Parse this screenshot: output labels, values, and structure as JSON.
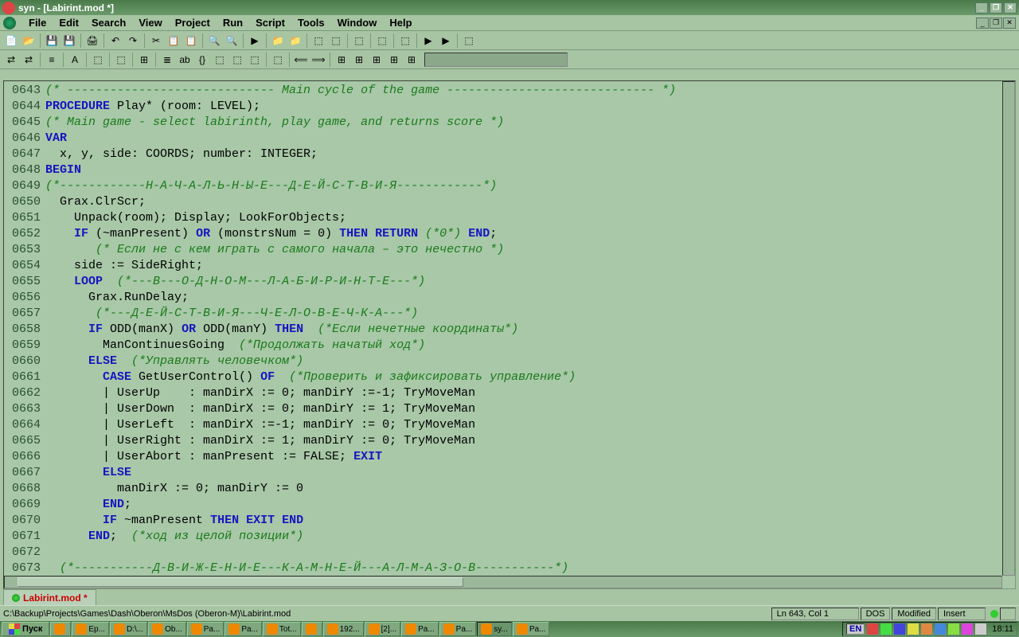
{
  "title": "syn - [Labirint.mod *]",
  "menu": [
    "File",
    "Edit",
    "Search",
    "View",
    "Project",
    "Run",
    "Script",
    "Tools",
    "Window",
    "Help"
  ],
  "tab": {
    "name": "Labirint.mod *"
  },
  "status": {
    "path": "C:\\Backup\\Projects\\Games\\Dash\\Oberon\\MsDos (Oberon-M)\\Labirint.mod",
    "pos": "Ln 643, Col 1",
    "enc": "DOS",
    "mod": "Modified",
    "ins": "Insert"
  },
  "taskbar": {
    "start": "Пуск",
    "tasks": [
      "",
      "Ер...",
      "D:\\...",
      "Ob...",
      "Pa...",
      "Pa...",
      "Tot...",
      "",
      "192...",
      "[2]...",
      "Pa...",
      "Pa...",
      "sy...",
      "Pa..."
    ],
    "lang": "EN",
    "clock": "18:11"
  },
  "code": [
    {
      "n": "0643",
      "seg": [
        {
          "c": "cm",
          "t": "(* ----------------------------- Main cycle of the game ----------------------------- *)"
        }
      ]
    },
    {
      "n": "0644",
      "seg": [
        {
          "c": "kw",
          "t": "PROCEDURE"
        },
        {
          "c": "txt",
          "t": " Play* (room: LEVEL);"
        }
      ]
    },
    {
      "n": "0645",
      "seg": [
        {
          "c": "cm",
          "t": "(* Main game - select labirinth, play game, and returns score *)"
        }
      ]
    },
    {
      "n": "0646",
      "seg": [
        {
          "c": "kw",
          "t": "VAR"
        }
      ]
    },
    {
      "n": "0647",
      "seg": [
        {
          "c": "txt",
          "t": "  x, y, side: COORDS; number: INTEGER;"
        }
      ]
    },
    {
      "n": "0648",
      "seg": [
        {
          "c": "kw",
          "t": "BEGIN"
        }
      ]
    },
    {
      "n": "0649",
      "seg": [
        {
          "c": "cm",
          "t": "(*------------Н-А-Ч-А-Л-Ь-Н-Ы-Е---Д-Е-Й-С-Т-В-И-Я------------*)"
        }
      ]
    },
    {
      "n": "0650",
      "seg": [
        {
          "c": "txt",
          "t": "  Grax.ClrScr;"
        }
      ]
    },
    {
      "n": "0651",
      "seg": [
        {
          "c": "txt",
          "t": "    Unpack(room); Display; LookForObjects;"
        }
      ]
    },
    {
      "n": "0652",
      "seg": [
        {
          "c": "txt",
          "t": "    "
        },
        {
          "c": "kw",
          "t": "IF"
        },
        {
          "c": "txt",
          "t": " (~manPresent) "
        },
        {
          "c": "kw",
          "t": "OR"
        },
        {
          "c": "txt",
          "t": " (monstrsNum = 0) "
        },
        {
          "c": "kw",
          "t": "THEN RETURN"
        },
        {
          "c": "txt",
          "t": " "
        },
        {
          "c": "cm",
          "t": "(*0*)"
        },
        {
          "c": "txt",
          "t": " "
        },
        {
          "c": "kw",
          "t": "END"
        },
        {
          "c": "txt",
          "t": ";"
        }
      ]
    },
    {
      "n": "0653",
      "seg": [
        {
          "c": "txt",
          "t": "       "
        },
        {
          "c": "cm",
          "t": "(* Если не с кем играть с самого начала – это нечестно *)"
        }
      ]
    },
    {
      "n": "0654",
      "seg": [
        {
          "c": "txt",
          "t": "    side := SideRight;"
        }
      ]
    },
    {
      "n": "0655",
      "seg": [
        {
          "c": "txt",
          "t": "    "
        },
        {
          "c": "kw",
          "t": "LOOP"
        },
        {
          "c": "txt",
          "t": "  "
        },
        {
          "c": "cm",
          "t": "(*---В---О-Д-Н-О-М---Л-А-Б-И-Р-И-Н-Т-Е---*)"
        }
      ]
    },
    {
      "n": "0656",
      "seg": [
        {
          "c": "txt",
          "t": "      Grax.RunDelay;"
        }
      ]
    },
    {
      "n": "0657",
      "seg": [
        {
          "c": "txt",
          "t": "       "
        },
        {
          "c": "cm",
          "t": "(*---Д-Е-Й-С-Т-В-И-Я---Ч-Е-Л-О-В-Е-Ч-К-А---*)"
        }
      ]
    },
    {
      "n": "0658",
      "seg": [
        {
          "c": "txt",
          "t": "      "
        },
        {
          "c": "kw",
          "t": "IF"
        },
        {
          "c": "txt",
          "t": " ODD(manX) "
        },
        {
          "c": "kw",
          "t": "OR"
        },
        {
          "c": "txt",
          "t": " ODD(manY) "
        },
        {
          "c": "kw",
          "t": "THEN"
        },
        {
          "c": "txt",
          "t": "  "
        },
        {
          "c": "cm",
          "t": "(*Если нечетные координаты*)"
        }
      ]
    },
    {
      "n": "0659",
      "seg": [
        {
          "c": "txt",
          "t": "        ManContinuesGoing  "
        },
        {
          "c": "cm",
          "t": "(*Продолжать начатый ход*)"
        }
      ]
    },
    {
      "n": "0660",
      "seg": [
        {
          "c": "txt",
          "t": "      "
        },
        {
          "c": "kw",
          "t": "ELSE"
        },
        {
          "c": "txt",
          "t": "  "
        },
        {
          "c": "cm",
          "t": "(*Управлять человечком*)"
        }
      ]
    },
    {
      "n": "0661",
      "seg": [
        {
          "c": "txt",
          "t": "        "
        },
        {
          "c": "kw",
          "t": "CASE"
        },
        {
          "c": "txt",
          "t": " GetUserControl() "
        },
        {
          "c": "kw",
          "t": "OF"
        },
        {
          "c": "txt",
          "t": "  "
        },
        {
          "c": "cm",
          "t": "(*Проверить и зафиксировать управление*)"
        }
      ]
    },
    {
      "n": "0662",
      "seg": [
        {
          "c": "txt",
          "t": "        | UserUp    : manDirX := 0; manDirY :=-1; TryMoveMan"
        }
      ]
    },
    {
      "n": "0663",
      "seg": [
        {
          "c": "txt",
          "t": "        | UserDown  : manDirX := 0; manDirY := 1; TryMoveMan"
        }
      ]
    },
    {
      "n": "0664",
      "seg": [
        {
          "c": "txt",
          "t": "        | UserLeft  : manDirX :=-1; manDirY := 0; TryMoveMan"
        }
      ]
    },
    {
      "n": "0665",
      "seg": [
        {
          "c": "txt",
          "t": "        | UserRight : manDirX := 1; manDirY := 0; TryMoveMan"
        }
      ]
    },
    {
      "n": "0666",
      "seg": [
        {
          "c": "txt",
          "t": "        | UserAbort : manPresent := FALSE; "
        },
        {
          "c": "kw",
          "t": "EXIT"
        }
      ]
    },
    {
      "n": "0667",
      "seg": [
        {
          "c": "txt",
          "t": "        "
        },
        {
          "c": "kw",
          "t": "ELSE"
        }
      ]
    },
    {
      "n": "0668",
      "seg": [
        {
          "c": "txt",
          "t": "          manDirX := 0; manDirY := 0"
        }
      ]
    },
    {
      "n": "0669",
      "seg": [
        {
          "c": "txt",
          "t": "        "
        },
        {
          "c": "kw",
          "t": "END"
        },
        {
          "c": "txt",
          "t": ";"
        }
      ]
    },
    {
      "n": "0670",
      "seg": [
        {
          "c": "txt",
          "t": "        "
        },
        {
          "c": "kw",
          "t": "IF"
        },
        {
          "c": "txt",
          "t": " ~manPresent "
        },
        {
          "c": "kw",
          "t": "THEN EXIT END"
        }
      ]
    },
    {
      "n": "0671",
      "seg": [
        {
          "c": "txt",
          "t": "      "
        },
        {
          "c": "kw",
          "t": "END"
        },
        {
          "c": "txt",
          "t": ";  "
        },
        {
          "c": "cm",
          "t": "(*ход из целой позиции*)"
        }
      ]
    },
    {
      "n": "0672",
      "seg": []
    },
    {
      "n": "0673",
      "seg": [
        {
          "c": "cm",
          "t": "  (*-----------Д-В-И-Ж-Е-Н-И-Е---К-А-М-Н-Е-Й---А-Л-М-А-З-О-В-----------*)"
        }
      ]
    }
  ],
  "tb1": [
    "📄",
    "📂",
    "",
    "💾",
    "💾",
    "",
    "🖨",
    "",
    "↶",
    "↷",
    "",
    "✂",
    "📋",
    "📋",
    "",
    "🔍",
    "🔍",
    "",
    "▶",
    "",
    "📁",
    "📁",
    "",
    "⬚",
    "⬚",
    "",
    "⬚",
    "",
    "⬚",
    "",
    "⬚",
    "",
    "▶",
    "▶",
    "",
    "⬚"
  ],
  "tb2": [
    "⇄",
    "⇄",
    "",
    "≡",
    "",
    "A",
    "",
    "⬚",
    "",
    "⬚",
    "",
    "⊞",
    "",
    "≣",
    "ab",
    "{}",
    "⬚",
    "⬚",
    "⬚",
    "",
    "⬚",
    "",
    "⟸",
    "⟹",
    "",
    "⊞",
    "⊞",
    "⊞",
    "⊞",
    "⊞"
  ]
}
